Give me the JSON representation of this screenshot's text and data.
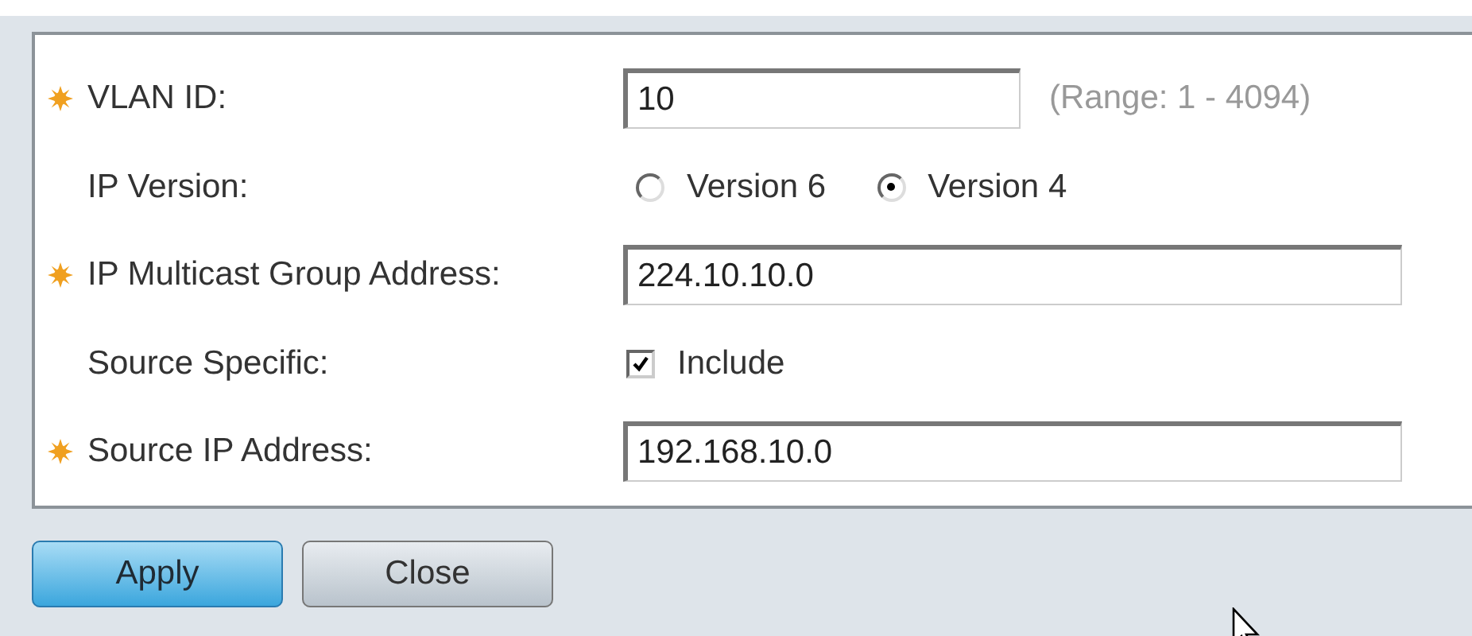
{
  "form": {
    "fields": [
      {
        "kind": "text",
        "label": "VLAN ID:",
        "required": true,
        "value": "10",
        "hint": "(Range: 1 - 4094)",
        "wide": false
      },
      {
        "kind": "radio",
        "label": "IP Version:",
        "required": false,
        "options": [
          {
            "label": "Version 6",
            "selected": false
          },
          {
            "label": "Version 4",
            "selected": true
          }
        ]
      },
      {
        "kind": "text",
        "label": "IP Multicast Group Address:",
        "required": true,
        "value": "224.10.10.0",
        "wide": true
      },
      {
        "kind": "checkbox",
        "label": "Source Specific:",
        "required": false,
        "option": "Include",
        "checked": true
      },
      {
        "kind": "text",
        "label": "Source IP Address:",
        "required": true,
        "value": "192.168.10.0",
        "wide": true
      }
    ]
  },
  "buttons": [
    {
      "label": "Apply",
      "primary": true
    },
    {
      "label": "Close",
      "primary": false
    }
  ]
}
